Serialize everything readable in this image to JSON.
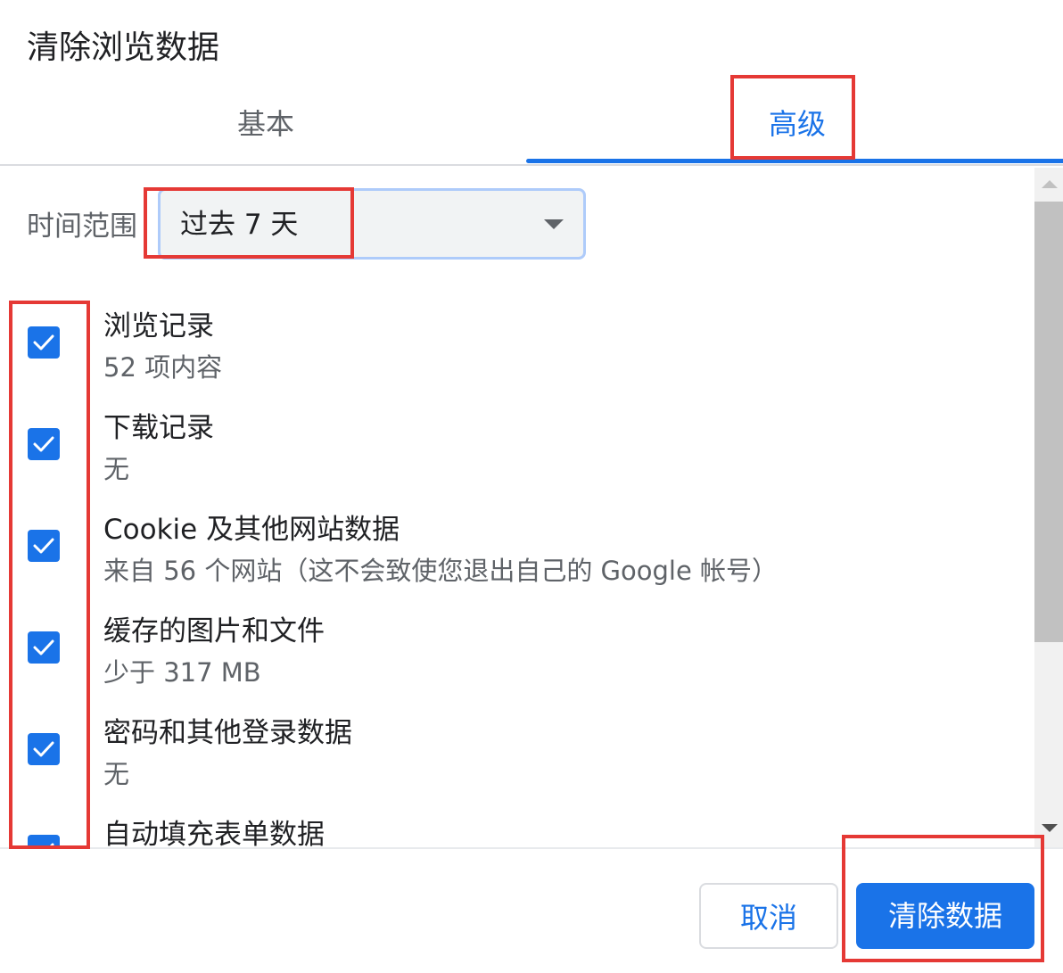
{
  "dialog": {
    "title": "清除浏览数据"
  },
  "tabs": [
    {
      "label": "基本",
      "active": false
    },
    {
      "label": "高级",
      "active": true
    }
  ],
  "time_range": {
    "label": "时间范围",
    "selected": "过去 7 天"
  },
  "items": [
    {
      "title": "浏览记录",
      "subtitle": "52 项内容",
      "checked": true
    },
    {
      "title": "下载记录",
      "subtitle": "无",
      "checked": true
    },
    {
      "title": "Cookie 及其他网站数据",
      "subtitle": "来自 56 个网站（这不会致使您退出自己的 Google 帐号）",
      "checked": true
    },
    {
      "title": "缓存的图片和文件",
      "subtitle": "少于 317 MB",
      "checked": true
    },
    {
      "title": "密码和其他登录数据",
      "subtitle": "无",
      "checked": true
    },
    {
      "title": "自动填充表单数据",
      "subtitle": "",
      "checked": true
    }
  ],
  "buttons": {
    "cancel": "取消",
    "clear": "清除数据"
  },
  "colors": {
    "accent": "#1a73e8",
    "annotation": "#e53935",
    "text_secondary": "#5f6368"
  }
}
